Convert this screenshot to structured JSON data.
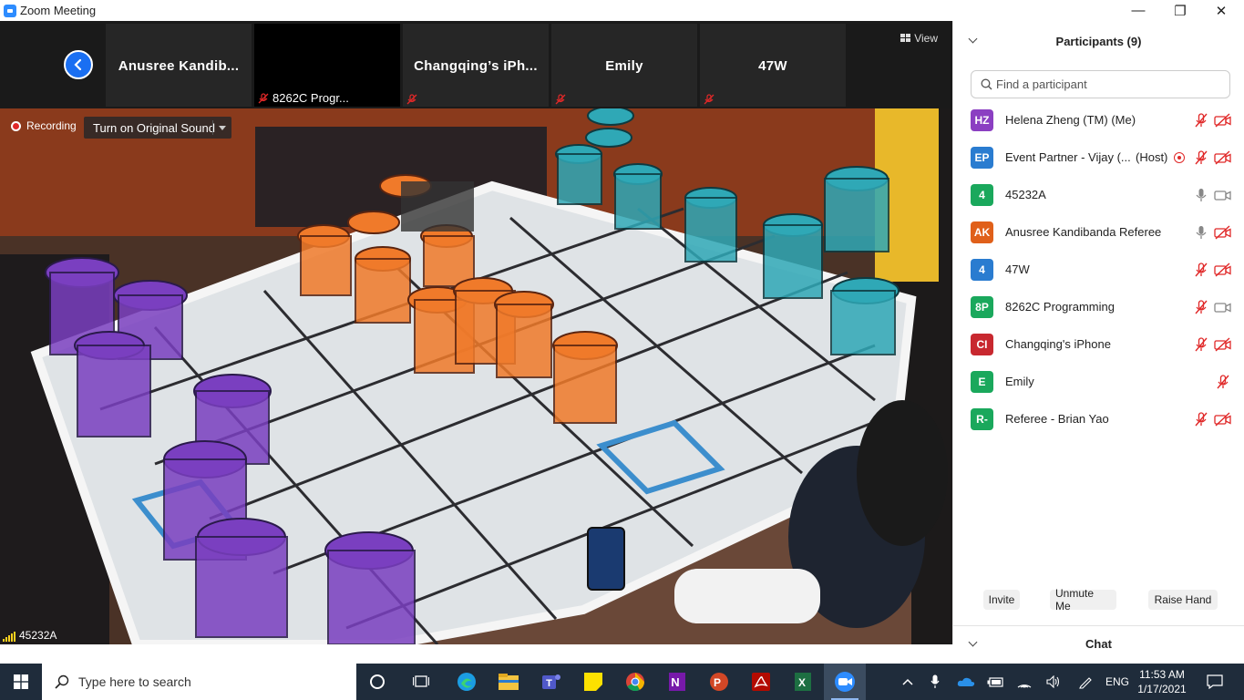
{
  "window": {
    "title": "Zoom Meeting",
    "controls": {
      "minimize": "—",
      "restore": "❐",
      "close": "✕"
    }
  },
  "strip": {
    "view_label": "View",
    "tiles": [
      {
        "name": "Anusree  Kandib...",
        "mute_label": ""
      },
      {
        "name": "",
        "mute_label": "8262C Progr..."
      },
      {
        "name": "Changqing’s  iPh...",
        "mute_label": ""
      },
      {
        "name": "Emily",
        "mute_label": ""
      },
      {
        "name": "47W",
        "mute_label": ""
      }
    ]
  },
  "video": {
    "recording_label": "Recording",
    "original_sound_label": "Turn on Original Sound",
    "active_speaker": "45232A"
  },
  "participants": {
    "title": "Participants (9)",
    "search_placeholder": "Find a participant",
    "list": [
      {
        "initials": "HZ",
        "name": "Helena Zheng (TM) (Me)",
        "extra": "",
        "color": "#8b3fc2",
        "mic": "muted",
        "cam": "off"
      },
      {
        "initials": "EP",
        "name": "Event Partner - Vijay (...",
        "extra": "(Host)",
        "color": "#2a7cd0",
        "mic": "muted",
        "cam": "off",
        "recording": true
      },
      {
        "initials": "4",
        "name": "45232A",
        "extra": "",
        "color": "#1aa85c",
        "mic": "on",
        "cam": "on"
      },
      {
        "initials": "AK",
        "name": "Anusree Kandibanda Referee",
        "extra": "",
        "color": "#e0601a",
        "mic": "on",
        "cam": "off"
      },
      {
        "initials": "4",
        "name": "47W",
        "extra": "",
        "color": "#2a7cd0",
        "mic": "muted",
        "cam": "off"
      },
      {
        "initials": "8P",
        "name": "8262C Programming",
        "extra": "",
        "color": "#1aa85c",
        "mic": "muted",
        "cam": "on"
      },
      {
        "initials": "CI",
        "name": "Changqing's iPhone",
        "extra": "",
        "color": "#c8282f",
        "mic": "muted",
        "cam": "off"
      },
      {
        "initials": "E",
        "name": "Emily",
        "extra": "",
        "color": "#1aa85c",
        "mic": "muted",
        "cam": "none"
      },
      {
        "initials": "R-",
        "name": "Referee - Brian Yao",
        "extra": "",
        "color": "#1aa85c",
        "mic": "muted",
        "cam": "off"
      }
    ],
    "buttons": {
      "invite": "Invite",
      "unmute": "Unmute Me",
      "raise_hand": "Raise Hand"
    },
    "chat_label": "Chat"
  },
  "taskbar": {
    "search_placeholder": "Type here to search",
    "language": "ENG",
    "time": "11:53 AM",
    "date": "1/17/2021",
    "apps": [
      "cortana-icon",
      "task-view-icon",
      "edge-icon",
      "file-explorer-icon",
      "teams-icon",
      "sticky-notes-icon",
      "chrome-icon",
      "onenote-icon",
      "powerpoint-icon",
      "acrobat-icon",
      "excel-icon",
      "zoom-icon"
    ]
  },
  "colors": {
    "accent": "#2d8cff",
    "muted": "#e02828",
    "strip_bg": "#1a1a1a",
    "taskbar": "#1f2c3b"
  }
}
